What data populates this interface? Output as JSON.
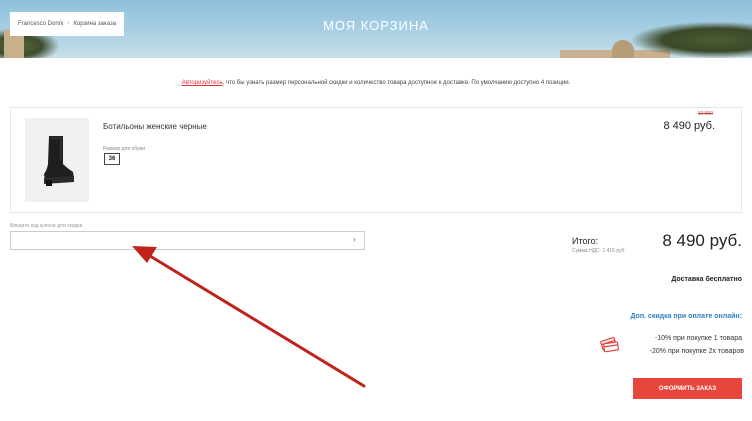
{
  "header": {
    "title": "МОЯ КОРЗИНА",
    "breadcrumb": [
      "Francesco Donni",
      "Корзина заказа"
    ]
  },
  "notice": {
    "link_text": "Авторизуйтесь",
    "text": ", что бы узнать размер персональной скидки и количество товара доступное к доставке. По умолчанию доступно 4 позиции."
  },
  "cart": {
    "items": [
      {
        "name": "Ботильоны женские черные",
        "size_label": "Размер для обуви",
        "size": "36",
        "old_price": "10 990",
        "price": "8 490 руб."
      }
    ]
  },
  "coupon": {
    "label": "Введите код купона для скидки",
    "placeholder": "",
    "submit_glyph": "›"
  },
  "summary": {
    "total_label": "Итого:",
    "vat": "Сумма НДС: 1 415 руб",
    "total_value": "8 490 руб.",
    "delivery": "Доставка бесплатно"
  },
  "promo": {
    "title": "Доп. скидка при оплате онлайн:",
    "lines": [
      "-10% при покупке 1 товара",
      "-20% при покупке 2х товаров"
    ],
    "icon": "credit-cards-icon"
  },
  "checkout": {
    "label": "ОФОРМИТЬ ЗАКАЗ",
    "color": "#e7463d"
  },
  "colors": {
    "accent": "#e7463d",
    "link": "#d33333",
    "promo": "#2f7fbf",
    "annotation_arrow": "#c0221c"
  }
}
